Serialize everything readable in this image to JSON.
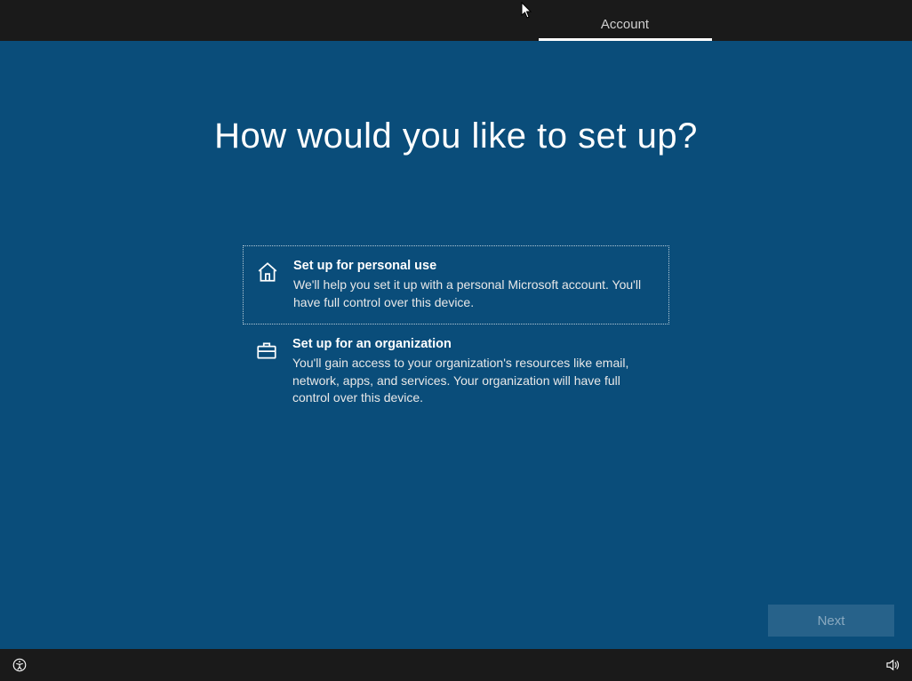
{
  "header": {
    "tab_label": "Account"
  },
  "title": "How would you like to set up?",
  "options": [
    {
      "title": "Set up for personal use",
      "desc": "We'll help you set it up with a personal Microsoft account. You'll have full control over this device."
    },
    {
      "title": "Set up for an organization",
      "desc": "You'll gain access to your organization's resources like email, network, apps, and services. Your organization will have full control over this device."
    }
  ],
  "buttons": {
    "next": "Next"
  }
}
